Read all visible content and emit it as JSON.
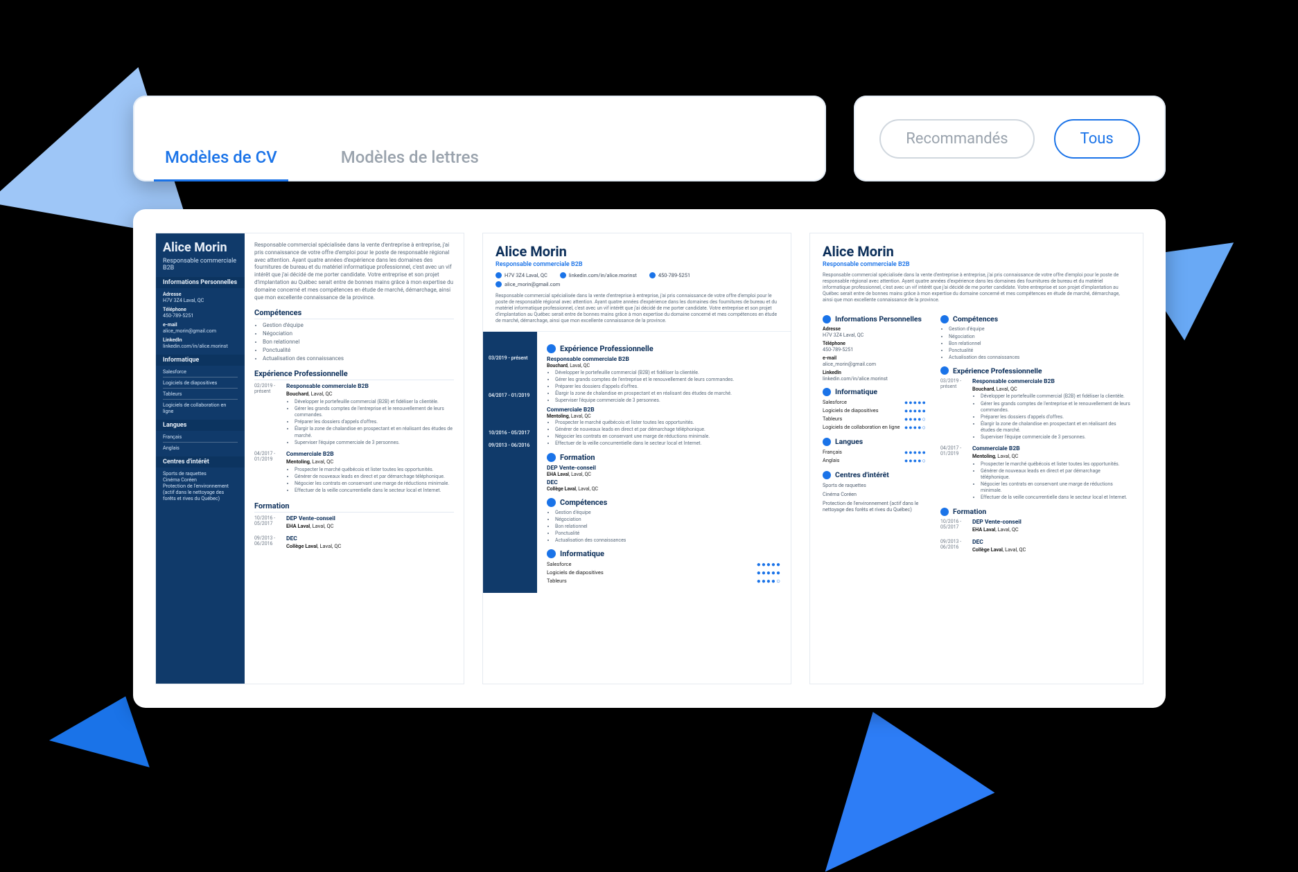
{
  "tabs": {
    "cv": "Modèles de CV",
    "letters": "Modèles de lettres"
  },
  "filters": {
    "recommended": "Recommandés",
    "all": "Tous"
  },
  "person": {
    "name": "Alice Morin",
    "title": "Responsable commerciale B2B",
    "summary": "Responsable commercial spécialisée dans la vente d'entreprise à entreprise, j'ai pris connaissance de votre offre d'emploi pour le poste de responsable régional avec attention. Ayant quatre années d'expérience dans les domaines des fournitures de bureau et du matériel informatique professionnel, c'est avec un vif intérêt que j'ai décidé de me porter candidate. Votre entreprise et son projet d'implantation au Québec serait entre de bonnes mains grâce à mon expertise du domaine concerné et mes compétences en étude de marché, démarchage, ainsi que mon excellente connaissance de la province."
  },
  "sections": {
    "info": "Informations Personnelles",
    "skills": "Compétences",
    "exp": "Expérience Professionnelle",
    "edu": "Formation",
    "it": "Informatique",
    "lang": "Langues",
    "interests": "Centres d'intérêt"
  },
  "contact": {
    "address_label": "Adresse",
    "address": "H7V 3Z4 Laval, QC",
    "phone_label": "Téléphone",
    "phone": "450-789-5251",
    "email_label": "e-mail",
    "email": "alice_morin@gmail.com",
    "linkedin_label": "LinkedIn",
    "linkedin": "linkedin.com/in/alice.morinst"
  },
  "skills": [
    "Gestion d'équipe",
    "Négociation",
    "Bon relationnel",
    "Ponctualité",
    "Actualisation des connaissances"
  ],
  "it": [
    "Salesforce",
    "Logiciels de diapositives",
    "Tableurs",
    "Logiciels de collaboration en ligne"
  ],
  "it_ratings": [
    "●●●●●",
    "●●●●●",
    "●●●●○",
    "●●●●○"
  ],
  "languages": [
    "Français",
    "Anglais"
  ],
  "lang_ratings": [
    "●●●●●",
    "●●●●○"
  ],
  "interests": [
    "Sports de raquettes",
    "Cinéma Coréen",
    "Protection de l'environnement (actif dans le nettoyage des forêts et rives du Québec)"
  ],
  "experience": [
    {
      "dates": "03/2019 - présent",
      "dates_short": "02/2019 - présent",
      "title": "Responsable commerciale B2B",
      "company": "Bouchard",
      "location": "Laval, QC",
      "bullets": [
        "Développer le portefeuille commercial (B2B) et fidéliser la clientèle.",
        "Gérer les grands comptes de l'entreprise et le renouvellement de leurs commandes.",
        "Préparer les dossiers d'appels d'offres.",
        "Élargir la zone de chalandise en prospectant et en réalisant des études de marché.",
        "Superviser l'équipe commerciale de 3 personnes."
      ]
    },
    {
      "dates": "04/2017 - 01/2019",
      "title": "Commerciale B2B",
      "company": "Mentoling",
      "location": "Laval, QC",
      "bullets": [
        "Prospecter le marché québécois et lister toutes les opportunités.",
        "Générer de nouveaux leads en direct et par démarchage téléphonique.",
        "Négocier les contrats en conservant une marge de réductions minimale.",
        "Effectuer de la veille concurrentielle dans le secteur local et Internet."
      ]
    }
  ],
  "education": [
    {
      "dates": "10/2016 - 05/2017",
      "title": "DEP Vente-conseil",
      "school": "EHA Laval",
      "location": "Laval, QC"
    },
    {
      "dates": "09/2013 - 06/2016",
      "title": "DEC",
      "school": "Collège Laval",
      "location": "Laval, QC"
    }
  ]
}
